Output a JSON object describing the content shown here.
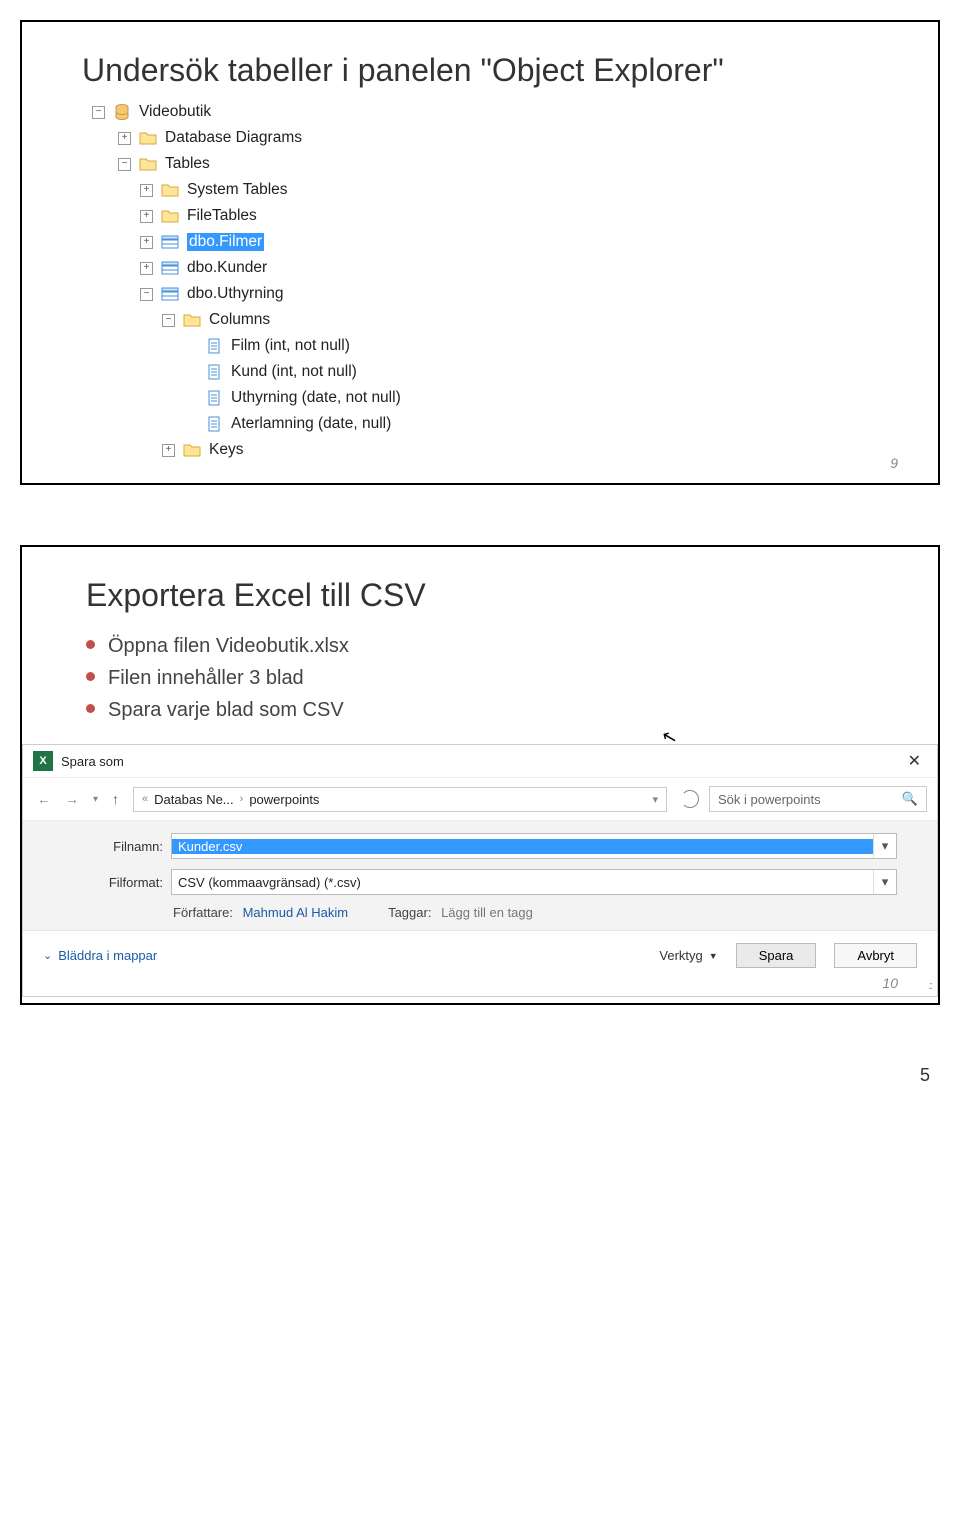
{
  "slide1": {
    "title": "Undersök tabeller i panelen \"Object Explorer\"",
    "page_number": "9",
    "tree": {
      "root": "Videobutik",
      "database_diagrams": "Database Diagrams",
      "tables": "Tables",
      "system_tables": "System Tables",
      "file_tables": "FileTables",
      "dbo_filmer": "dbo.Filmer",
      "dbo_kunder": "dbo.Kunder",
      "dbo_uthyrning": "dbo.Uthyrning",
      "columns": "Columns",
      "col_film": "Film (int, not null)",
      "col_kund": "Kund (int, not null)",
      "col_uthyrning": "Uthyrning (date, not null)",
      "col_aterlamning": "Aterlamning (date, null)",
      "keys": "Keys"
    }
  },
  "slide2": {
    "title": "Exportera Excel till CSV",
    "page_number": "10",
    "bullets": [
      "Öppna filen Videobutik.xlsx",
      "Filen innehåller 3 blad",
      "Spara varje blad som CSV"
    ],
    "dialog": {
      "title": "Spara som",
      "breadcrumb_a": "Databas Ne...",
      "breadcrumb_b": "powerpoints",
      "search_placeholder": "Sök i powerpoints",
      "filnamn_label": "Filnamn:",
      "filnamn_value": "Kunder.csv",
      "filformat_label": "Filformat:",
      "filformat_value": "CSV (kommaavgränsad) (*.csv)",
      "forfattare_label": "Författare:",
      "forfattare_value": "Mahmud Al Hakim",
      "taggar_label": "Taggar:",
      "taggar_value": "Lägg till en tagg",
      "browse_folders": "Bläddra i mappar",
      "verktyg": "Verktyg",
      "save_btn": "Spara",
      "cancel_btn": "Avbryt"
    }
  },
  "doc_page_number": "5"
}
